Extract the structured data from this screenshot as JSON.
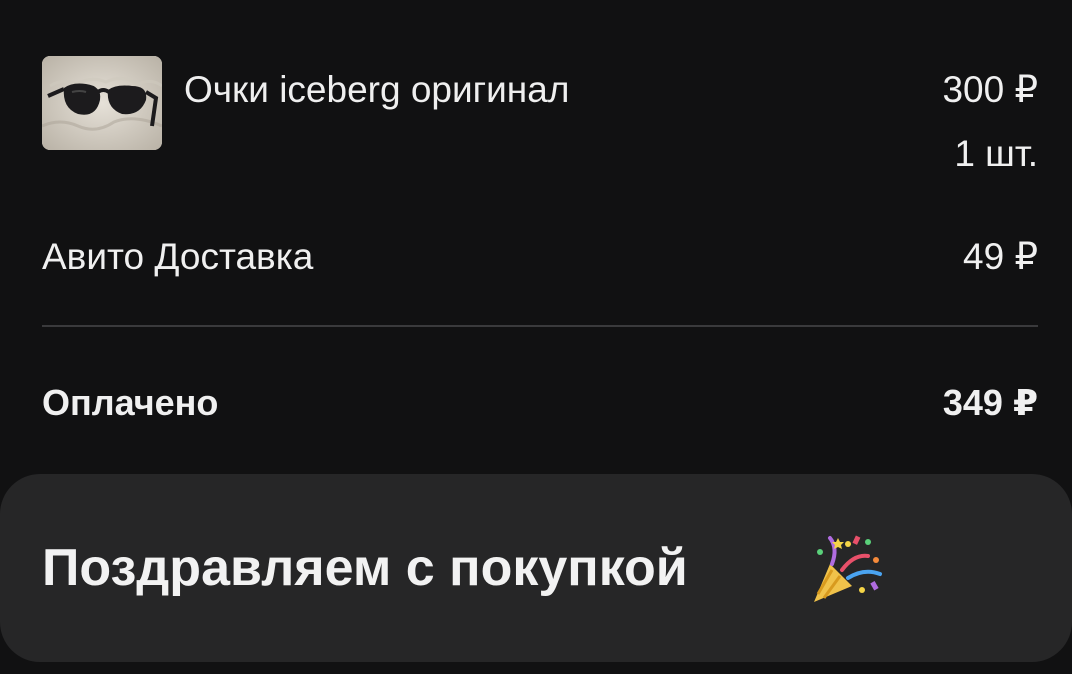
{
  "order": {
    "item": {
      "title": "Очки iceberg оригинал",
      "price": "300 ₽",
      "quantity": "1 шт.",
      "thumbnail_icon": "sunglasses-photo"
    },
    "delivery": {
      "label": "Авито Доставка",
      "price": "49 ₽"
    },
    "total": {
      "label": "Оплачено",
      "amount": "349 ₽"
    }
  },
  "banner": {
    "text": "Поздравляем с покупкой",
    "icon": "party-popper-icon"
  },
  "colors": {
    "background": "#111112",
    "card": "#262627",
    "divider": "#3a3a3c",
    "text": "#f0f0f0"
  }
}
